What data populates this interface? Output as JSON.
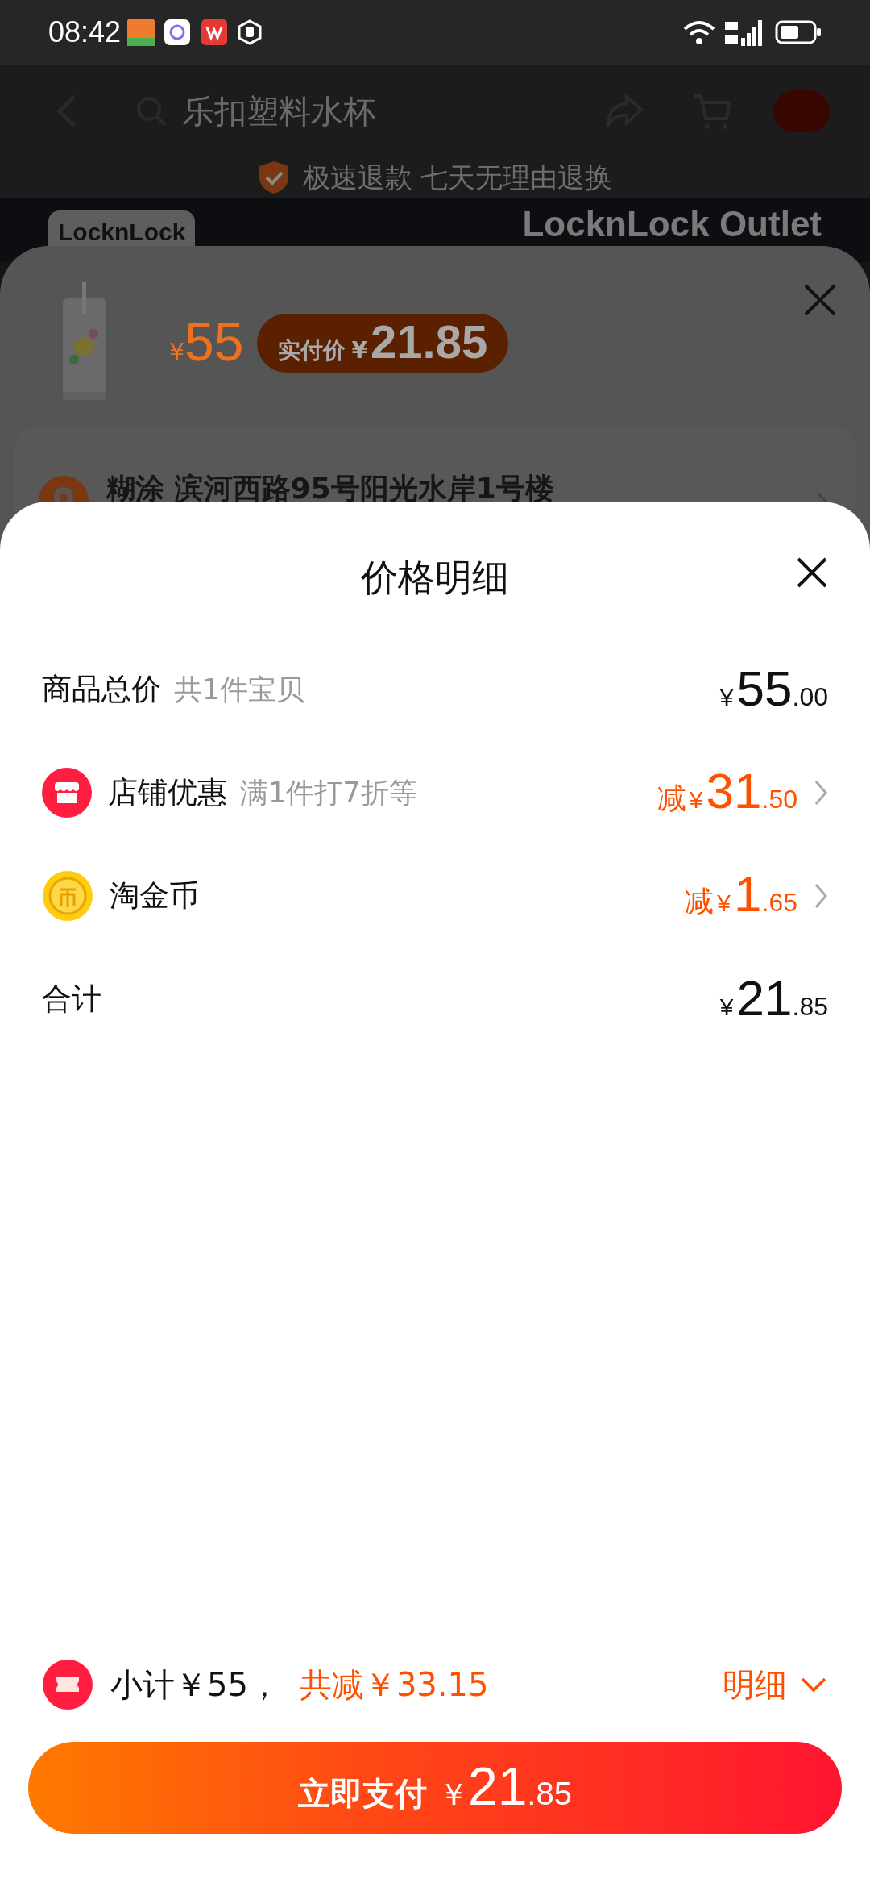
{
  "status_bar": {
    "time": "08:42"
  },
  "header": {
    "search_text": "乐扣塑料水杯"
  },
  "guarantee": "极速退款 七天无理由退换",
  "shop_banner": {
    "logo": "LocknLock",
    "name": "LocknLock Outlet"
  },
  "sku_sheet": {
    "currency": "¥",
    "price": "55",
    "actual_label": "实付价",
    "actual_currency": "¥",
    "actual_price": "21.85",
    "address": "糊涂 滨河西路95号阳光水岸1号楼"
  },
  "price_detail": {
    "title": "价格明细",
    "rows": [
      {
        "kind": "plain",
        "label": "商品总价",
        "note": "共1件宝贝",
        "prefix": "",
        "currency": "¥",
        "int": "55",
        "dec": ".00",
        "chevron": false
      },
      {
        "kind": "store_discount",
        "label": "店铺优惠",
        "note": "满1件打7折等",
        "prefix": "减",
        "currency": "¥",
        "int": "31",
        "dec": ".50",
        "chevron": true
      },
      {
        "kind": "coin_discount",
        "label": "淘金币",
        "note": "",
        "prefix": "减",
        "currency": "¥",
        "int": "1",
        "dec": ".65",
        "chevron": true
      },
      {
        "kind": "plain",
        "label": "合计",
        "note": "",
        "prefix": "",
        "currency": "¥",
        "int": "21",
        "dec": ".85",
        "chevron": false
      }
    ]
  },
  "footer": {
    "subtotal": "小计￥55，",
    "saved": "共减￥33.15",
    "detail_link": "明细",
    "pay_label": "立即支付",
    "pay_currency": "¥",
    "pay_int": "21",
    "pay_dec": ".85"
  }
}
